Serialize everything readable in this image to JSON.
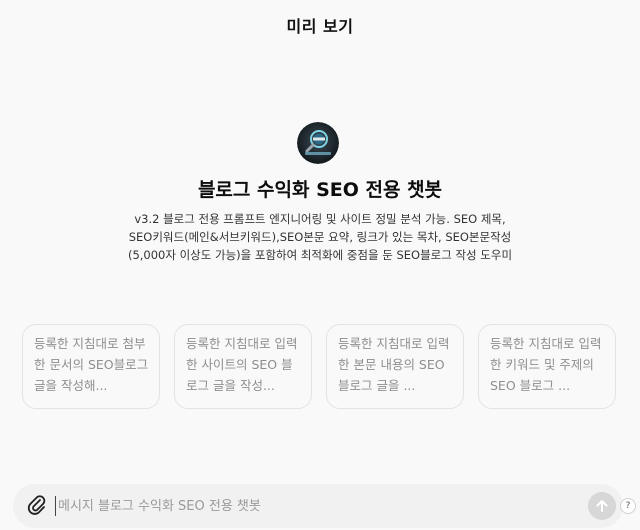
{
  "header": {
    "title": "미리 보기"
  },
  "bot": {
    "logo_icon": "blog-magnifier-logo",
    "name": "블로그 수익화 SEO 전용 챗봇",
    "description": "v3.2 블로그 전용 프롬프트 엔지니어링 및 사이트 정밀 분석 가능. SEO 제목, SEO키워드(메인&서브키워드),SEO본문 요약, 링크가 있는 목차, SEO본문작성(5,000자 이상도 가능)을 포함하여 최적화에 중점을 둔 SEO블로그 작성 도우미"
  },
  "starters": [
    "등록한 지침대로 첨부한 문서의 SEO블로그 글을 작성해...",
    "등록한 지침대로 입력한 사이트의 SEO 블로그 글을 작성...",
    "등록한 지침대로 입력한 본문 내용의 SEO 블로그 글을 ...",
    "등록한 지침대로 입력한 키워드 및 주제의 SEO 블로그 ..."
  ],
  "composer": {
    "placeholder": "메시지 블로그 수익화 SEO 전용 챗봇",
    "attach_icon": "paperclip-icon",
    "send_icon": "arrow-up-icon"
  },
  "help": {
    "label": "?"
  },
  "colors": {
    "background": "#f9f9f9",
    "card_border": "#e3e3e3",
    "card_text": "#8e8e8e",
    "composer_bg": "#f1f1f1",
    "send_disabled": "#d7d7d7"
  }
}
